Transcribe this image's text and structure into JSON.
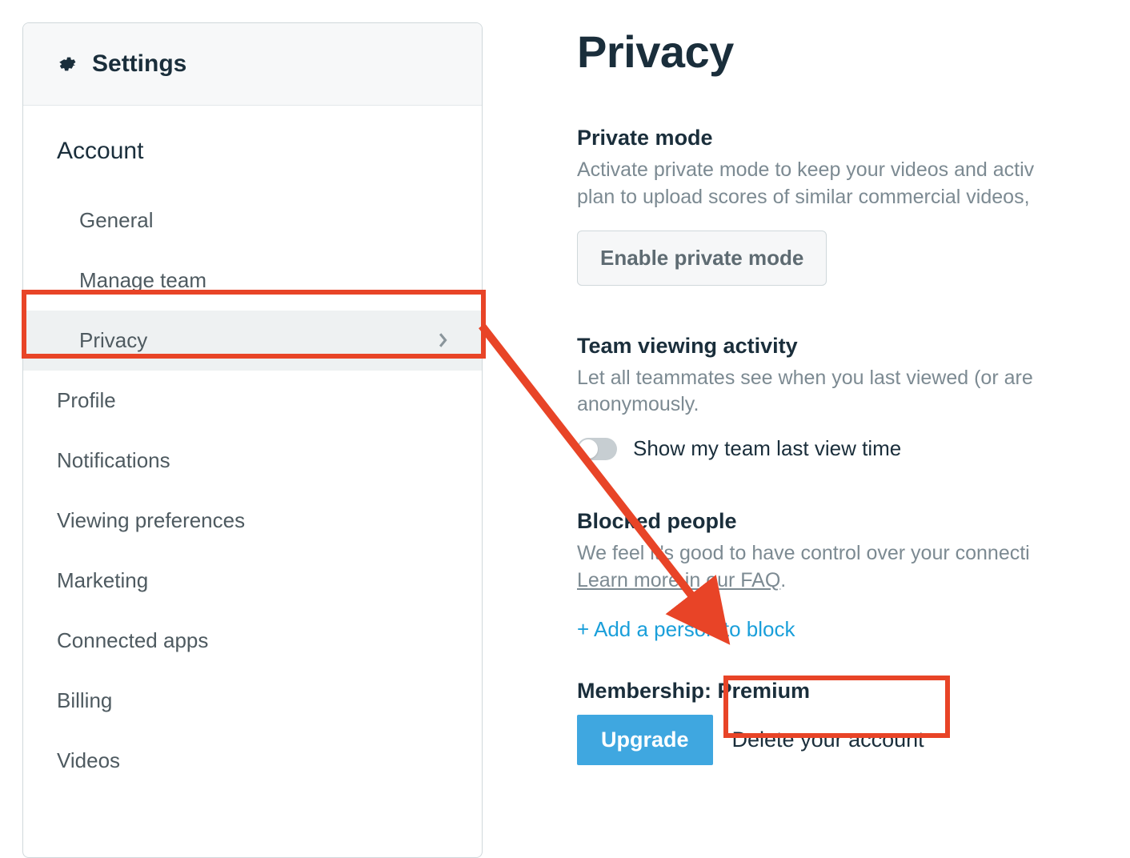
{
  "sidebar": {
    "header_title": "Settings",
    "sections": [
      {
        "title": "Account",
        "items": [
          {
            "label": "General"
          },
          {
            "label": "Manage team"
          },
          {
            "label": "Privacy",
            "active": true
          }
        ]
      }
    ],
    "top_items": [
      {
        "label": "Profile"
      },
      {
        "label": "Notifications"
      },
      {
        "label": "Viewing preferences"
      },
      {
        "label": "Marketing"
      },
      {
        "label": "Connected apps"
      },
      {
        "label": "Billing"
      },
      {
        "label": "Videos"
      }
    ]
  },
  "main": {
    "title": "Privacy",
    "private_mode": {
      "heading": "Private mode",
      "desc_line1": "Activate private mode to keep your videos and activ",
      "desc_line2": "plan to upload scores of similar commercial videos,",
      "button": "Enable private mode"
    },
    "team_activity": {
      "heading": "Team viewing activity",
      "desc_line1": "Let all teammates see when you last viewed (or are",
      "desc_line2": "anonymously.",
      "toggle_label": "Show my team last view time"
    },
    "blocked": {
      "heading": "Blocked people",
      "desc": "We feel it's good to have control over your connecti",
      "faq": "Learn more in our FAQ",
      "add_link": "+ Add a person to block"
    },
    "membership": {
      "heading": "Membership: Premium",
      "upgrade": "Upgrade",
      "delete": "Delete your account"
    }
  }
}
